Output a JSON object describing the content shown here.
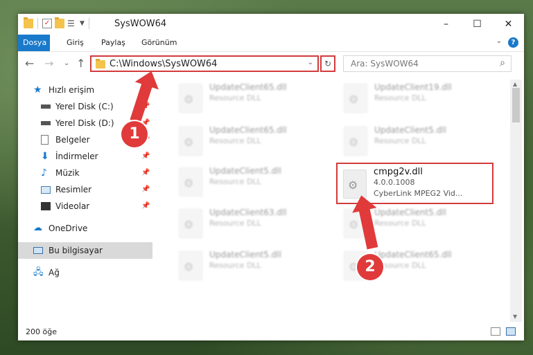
{
  "window": {
    "title": "SysWOW64"
  },
  "ribbon": {
    "tabs": [
      "Dosya",
      "Giriş",
      "Paylaş",
      "Görünüm"
    ],
    "help": "?"
  },
  "address": {
    "path": "C:\\Windows\\SysWOW64"
  },
  "search": {
    "placeholder": "Ara: SysWOW64"
  },
  "sidebar": {
    "items": [
      {
        "label": "Hızlı erişim",
        "icon": "star-icon"
      },
      {
        "label": "Yerel Disk (C:)",
        "icon": "drive-icon"
      },
      {
        "label": "Yerel Disk (D:)",
        "icon": "drive-icon"
      },
      {
        "label": "Belgeler",
        "icon": "document-icon"
      },
      {
        "label": "İndirmeler",
        "icon": "download-icon"
      },
      {
        "label": "Müzik",
        "icon": "music-icon"
      },
      {
        "label": "Resimler",
        "icon": "image-icon"
      },
      {
        "label": "Videolar",
        "icon": "video-icon"
      },
      {
        "label": "OneDrive",
        "icon": "cloud-icon"
      },
      {
        "label": "Bu bilgisayar",
        "icon": "computer-icon"
      },
      {
        "label": "Ağ",
        "icon": "network-icon"
      }
    ]
  },
  "files": {
    "left": [
      {
        "name": "UpdateClient65.dll",
        "type": "Resource DLL"
      },
      {
        "name": "UpdateClient65.dll",
        "type": "Resource DLL"
      },
      {
        "name": "UpdateClient5.dll",
        "type": "Resource DLL"
      },
      {
        "name": "UpdateClient63.dll",
        "type": "Resource DLL"
      },
      {
        "name": "UpdateClient5.dll",
        "type": "Resource DLL"
      }
    ],
    "right": [
      {
        "name": "UpdateClient19.dll",
        "type": "Resource DLL"
      },
      {
        "name": "UpdateClient5.dll",
        "type": "Resource DLL"
      },
      {
        "name": "UpdateClient5.dll",
        "type": "Resource DLL"
      },
      {
        "name": "UpdateClient65.dll",
        "type": "Resource DLL"
      }
    ],
    "highlighted": {
      "name": "cmpg2v.dll",
      "version": "4.0.0.1008",
      "description": "CyberLink MPEG2 Vid..."
    }
  },
  "status": {
    "count": "200 öğe"
  },
  "annotations": {
    "step1": "1",
    "step2": "2",
    "color": "#e03a3a"
  }
}
